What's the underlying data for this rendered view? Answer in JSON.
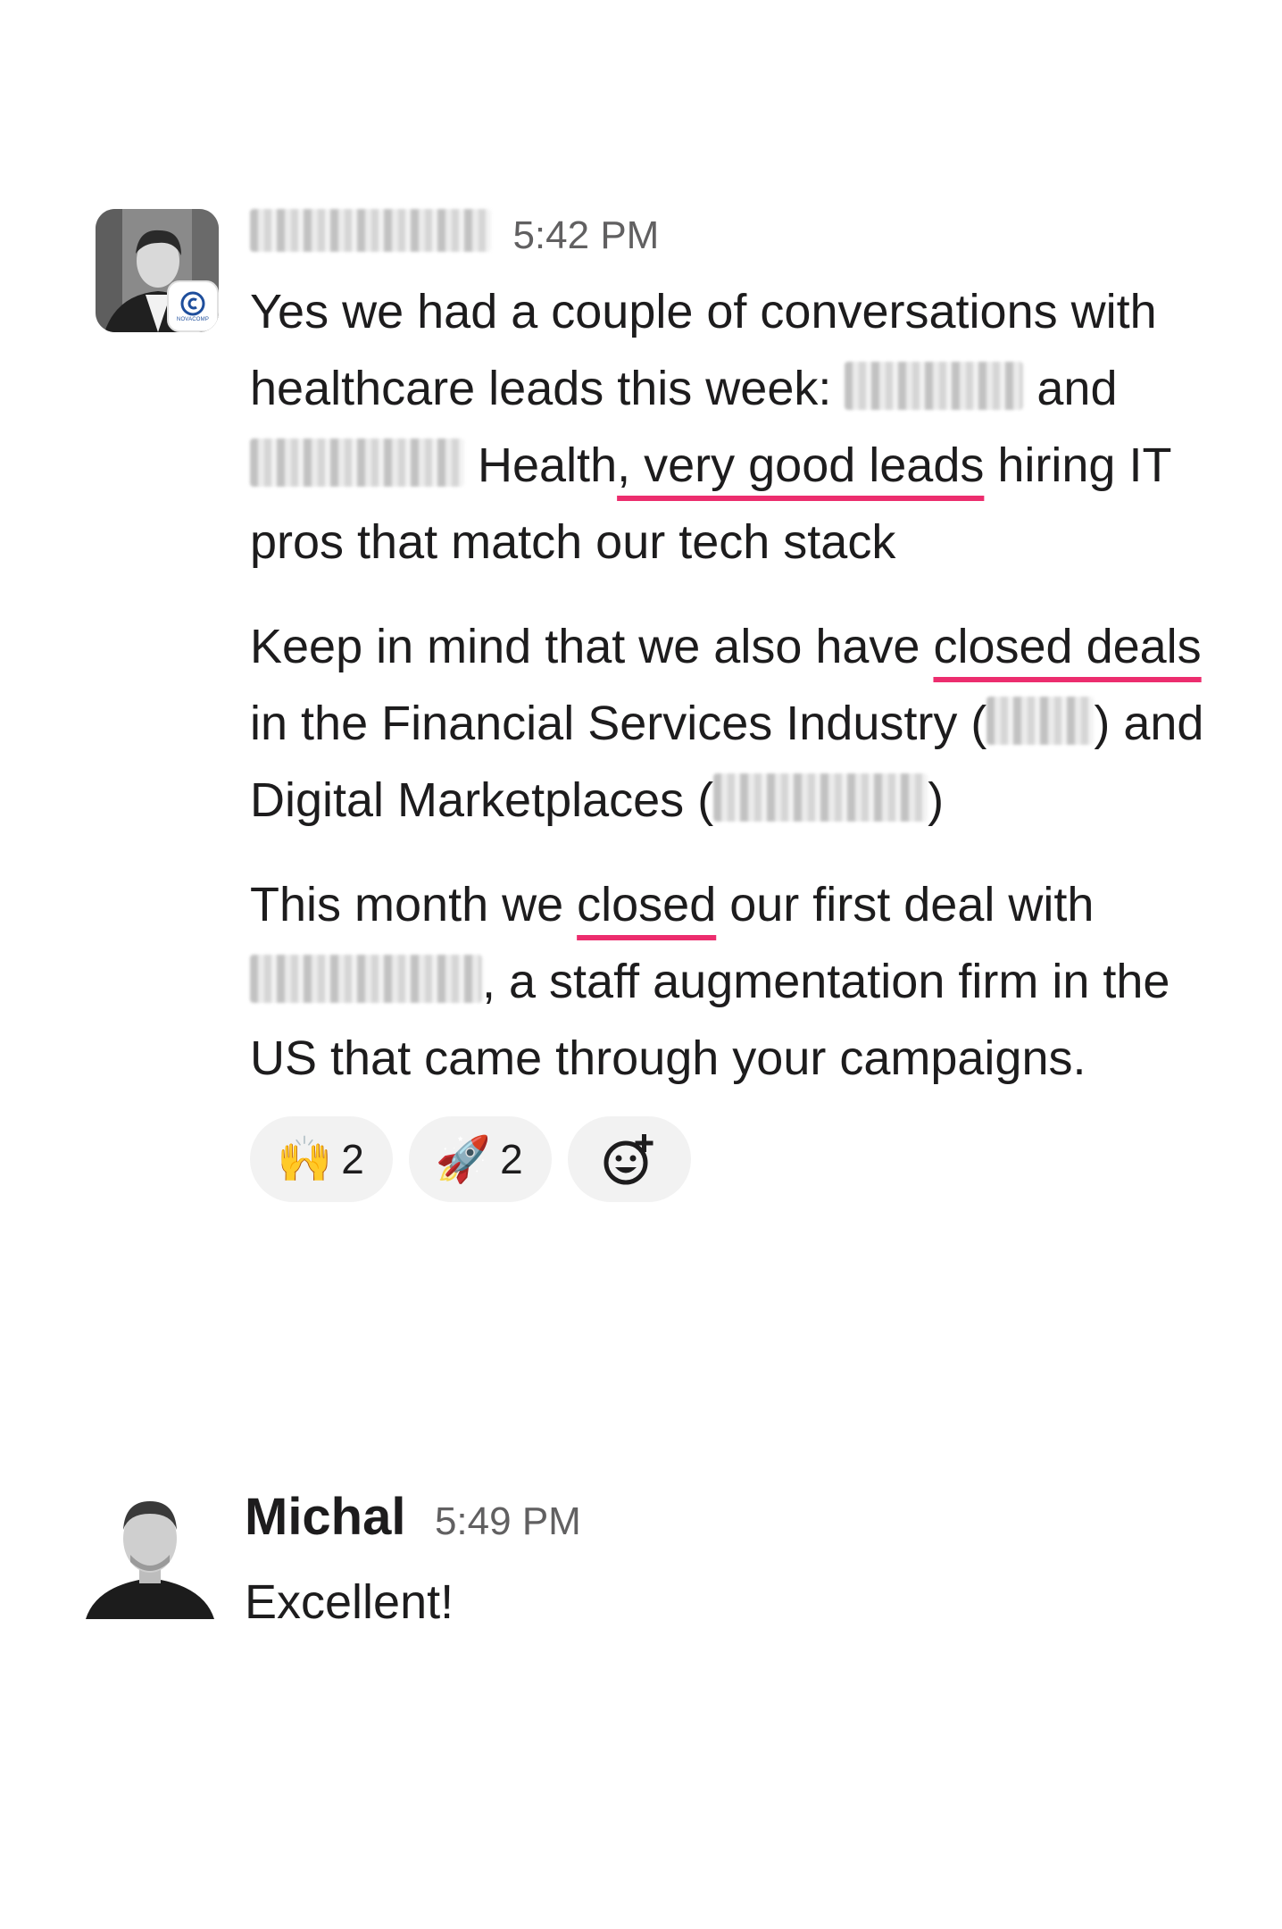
{
  "messages": [
    {
      "sender_redacted": true,
      "time": "5:42 PM",
      "avatar_badge_text": "NOVACOMP",
      "paragraphs": [
        {
          "parts": [
            {
              "t": "text",
              "v": "Yes we had a couple of conversations with healthcare leads this week: "
            },
            {
              "t": "redacted",
              "w": 200
            },
            {
              "t": "text",
              "v": " and "
            },
            {
              "t": "redacted",
              "w": 240
            },
            {
              "t": "text",
              "v": " Health"
            },
            {
              "t": "underline",
              "v": ", very good leads"
            },
            {
              "t": "text",
              "v": " hiring IT pros that match our tech stack"
            }
          ]
        },
        {
          "parts": [
            {
              "t": "text",
              "v": "Keep in mind that we also have "
            },
            {
              "t": "underline",
              "v": "closed deals"
            },
            {
              "t": "text",
              "v": " in the Financial Services Industry ("
            },
            {
              "t": "redacted",
              "w": 120
            },
            {
              "t": "text",
              "v": ") and Digital Marketplaces ("
            },
            {
              "t": "redacted",
              "w": 240
            },
            {
              "t": "text",
              "v": ")"
            }
          ]
        },
        {
          "parts": [
            {
              "t": "text",
              "v": "This month we "
            },
            {
              "t": "underline",
              "v": "closed"
            },
            {
              "t": "text",
              "v": " our first deal with "
            },
            {
              "t": "redacted",
              "w": 260
            },
            {
              "t": "text",
              "v": ", a staff augmentation firm in the US that came through your campaigns."
            }
          ]
        }
      ],
      "reactions": [
        {
          "icon": "raising-hands-emoji",
          "emoji": "🙌",
          "count": "2"
        },
        {
          "icon": "rocket-emoji",
          "emoji": "🚀",
          "count": "2"
        }
      ],
      "add_reaction_icon": "add-reaction-icon"
    },
    {
      "sender": "Michal",
      "time": "5:49 PM",
      "text": "Excellent!"
    }
  ],
  "colors": {
    "highlight_underline": "#ec2d6e",
    "timestamp": "#616061",
    "reaction_bg": "#f2f2f2"
  }
}
